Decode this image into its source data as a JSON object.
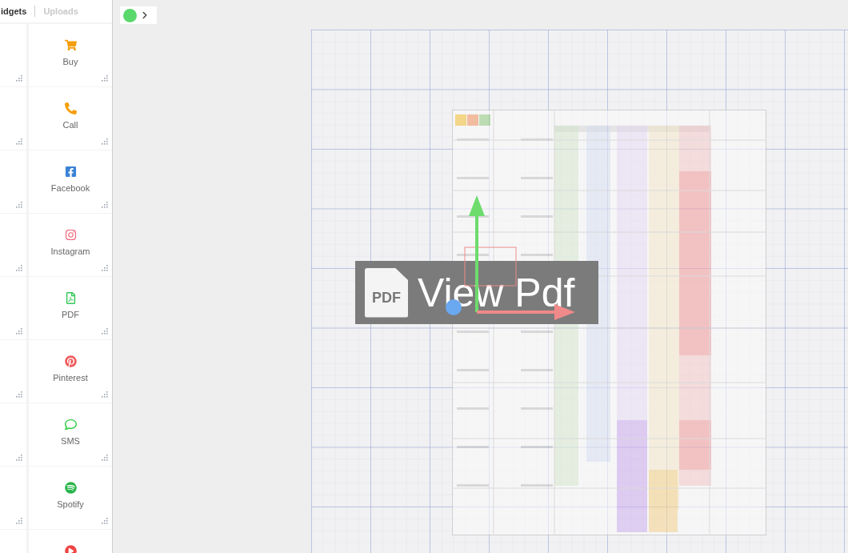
{
  "tabs": [
    {
      "label": "idgets",
      "selected": true
    },
    {
      "label": "Uploads",
      "selected": false
    }
  ],
  "widgets": [
    {
      "kind": "cart",
      "label": "Buy",
      "color": "#f59e0b"
    },
    {
      "kind": "phone",
      "label": "Call",
      "color": "#f59e0b"
    },
    {
      "kind": "facebook",
      "label": "Facebook",
      "color": "#3b82d6"
    },
    {
      "kind": "instagram",
      "label": "Instagram",
      "color": "#f06277"
    },
    {
      "kind": "pdf",
      "label": "PDF",
      "color": "#34c759"
    },
    {
      "kind": "pinterest",
      "label": "Pinterest",
      "color": "#ee5a5a"
    },
    {
      "kind": "sms",
      "label": "SMS",
      "color": "#2ecc40"
    },
    {
      "kind": "spotify",
      "label": "Spotify",
      "color": "#28b44a"
    },
    {
      "kind": "play",
      "color": "#ee4444"
    }
  ],
  "overlay": {
    "badge": "PDF",
    "label": "View Pdf"
  }
}
